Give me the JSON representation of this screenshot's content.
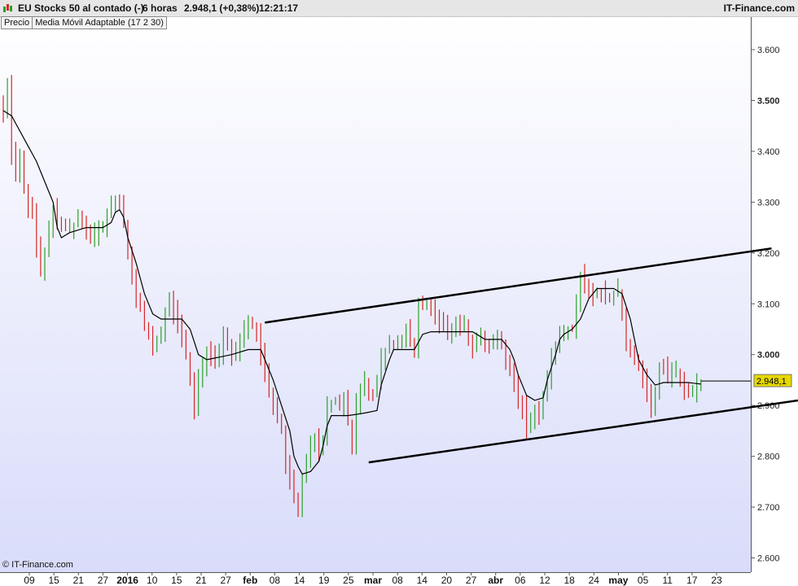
{
  "header": {
    "instrument": "EU Stocks 50 al contado (-)",
    "timeframe": "6 horas",
    "last": "2.948,1 (+0,38%)",
    "time": "12:21:17",
    "brand": "IT-Finance.com"
  },
  "legend": {
    "price": "Precio",
    "indicator": "Media Móvil Adaptable (17 2 30)"
  },
  "copyright": "© IT-Finance.com",
  "colors": {
    "up": "#2ca02c",
    "down": "#d62728",
    "ma": "#000000",
    "trend": "#000000",
    "bg_top": "#ffffff",
    "bg_bottom": "#d9dcfa",
    "price_tag": "#e6d800"
  },
  "chart_data": {
    "type": "line",
    "y_axis": {
      "ticks": [
        3600,
        3500,
        3400,
        3300,
        3200,
        3100,
        3000,
        2900,
        2800,
        2700,
        2600
      ],
      "labels": [
        "3.600",
        "3.500",
        "3.400",
        "3.300",
        "3.200",
        "3.100",
        "3.000",
        "2.900",
        "2.800",
        "2.700",
        "2.600"
      ],
      "bold": [
        3500,
        3000
      ],
      "ylim": [
        2585,
        3670
      ]
    },
    "x_axis": {
      "labels": [
        "09",
        "15",
        "21",
        "27",
        "2016",
        "10",
        "15",
        "21",
        "27",
        "feb",
        "08",
        "14",
        "19",
        "25",
        "mar",
        "08",
        "14",
        "20",
        "27",
        "abr",
        "06",
        "12",
        "18",
        "24",
        "may",
        "05",
        "11",
        "17",
        "23"
      ],
      "bold": [
        "2016",
        "feb",
        "mar",
        "abr",
        "may"
      ]
    },
    "last_price": {
      "value": 2948.1,
      "label": "2.948,1"
    },
    "ma_anchors": [
      [
        0,
        3480
      ],
      [
        2,
        3470
      ],
      [
        4,
        3440
      ],
      [
        6,
        3410
      ],
      [
        8,
        3380
      ],
      [
        10,
        3340
      ],
      [
        12,
        3300
      ],
      [
        13,
        3250
      ],
      [
        14,
        3230
      ],
      [
        16,
        3240
      ],
      [
        20,
        3250
      ],
      [
        24,
        3250
      ],
      [
        26,
        3260
      ],
      [
        27,
        3280
      ],
      [
        28,
        3285
      ],
      [
        29,
        3270
      ],
      [
        30,
        3230
      ],
      [
        32,
        3180
      ],
      [
        34,
        3120
      ],
      [
        36,
        3080
      ],
      [
        38,
        3070
      ],
      [
        43,
        3070
      ],
      [
        45,
        3050
      ],
      [
        47,
        3000
      ],
      [
        49,
        2990
      ],
      [
        55,
        3000
      ],
      [
        59,
        3010
      ],
      [
        62,
        3010
      ],
      [
        63,
        2990
      ],
      [
        65,
        2950
      ],
      [
        67,
        2900
      ],
      [
        69,
        2850
      ],
      [
        70,
        2800
      ],
      [
        71,
        2780
      ],
      [
        72,
        2765
      ],
      [
        74,
        2770
      ],
      [
        76,
        2790
      ],
      [
        77,
        2820
      ],
      [
        78,
        2860
      ],
      [
        79,
        2880
      ],
      [
        83,
        2880
      ],
      [
        87,
        2885
      ],
      [
        90,
        2890
      ],
      [
        91,
        2940
      ],
      [
        93,
        2990
      ],
      [
        94,
        3010
      ],
      [
        99,
        3010
      ],
      [
        101,
        3040
      ],
      [
        103,
        3045
      ],
      [
        113,
        3045
      ],
      [
        116,
        3030
      ],
      [
        120,
        3030
      ],
      [
        122,
        3010
      ],
      [
        123,
        2990
      ],
      [
        124,
        2960
      ],
      [
        126,
        2920
      ],
      [
        128,
        2910
      ],
      [
        130,
        2915
      ],
      [
        131,
        2950
      ],
      [
        133,
        3000
      ],
      [
        134,
        3030
      ],
      [
        135,
        3040
      ],
      [
        137,
        3050
      ],
      [
        139,
        3070
      ],
      [
        141,
        3110
      ],
      [
        143,
        3130
      ],
      [
        147,
        3130
      ],
      [
        149,
        3120
      ],
      [
        151,
        3070
      ],
      [
        152,
        3030
      ],
      [
        153,
        2990
      ],
      [
        155,
        2960
      ],
      [
        157,
        2940
      ],
      [
        159,
        2945
      ],
      [
        161,
        2945
      ],
      [
        165,
        2945
      ],
      [
        168,
        2942
      ]
    ],
    "price_anchors": [
      [
        0,
        3480
      ],
      [
        1,
        3530
      ],
      [
        2,
        3400
      ],
      [
        3,
        3360
      ],
      [
        4,
        3380
      ],
      [
        5,
        3330
      ],
      [
        6,
        3300
      ],
      [
        7,
        3280
      ],
      [
        8,
        3210
      ],
      [
        9,
        3170
      ],
      [
        10,
        3200
      ],
      [
        11,
        3240
      ],
      [
        12,
        3280
      ],
      [
        14,
        3260
      ],
      [
        16,
        3250
      ],
      [
        18,
        3270
      ],
      [
        20,
        3240
      ],
      [
        22,
        3230
      ],
      [
        24,
        3260
      ],
      [
        26,
        3290
      ],
      [
        27,
        3310
      ],
      [
        28,
        3300
      ],
      [
        29,
        3260
      ],
      [
        30,
        3190
      ],
      [
        32,
        3120
      ],
      [
        34,
        3060
      ],
      [
        36,
        3020
      ],
      [
        38,
        3050
      ],
      [
        40,
        3110
      ],
      [
        42,
        3060
      ],
      [
        44,
        3000
      ],
      [
        45,
        2940
      ],
      [
        46,
        2890
      ],
      [
        47,
        2950
      ],
      [
        49,
        3010
      ],
      [
        51,
        2980
      ],
      [
        53,
        3040
      ],
      [
        55,
        3000
      ],
      [
        57,
        3030
      ],
      [
        59,
        3060
      ],
      [
        61,
        3040
      ],
      [
        62,
        3000
      ],
      [
        63,
        2960
      ],
      [
        65,
        2900
      ],
      [
        67,
        2850
      ],
      [
        68,
        2780
      ],
      [
        69,
        2760
      ],
      [
        70,
        2720
      ],
      [
        71,
        2700
      ],
      [
        72,
        2760
      ],
      [
        74,
        2820
      ],
      [
        75,
        2830
      ],
      [
        76,
        2800
      ],
      [
        77,
        2830
      ],
      [
        78,
        2900
      ],
      [
        80,
        2910
      ],
      [
        82,
        2910
      ],
      [
        83,
        2870
      ],
      [
        84,
        2830
      ],
      [
        85,
        2900
      ],
      [
        87,
        2940
      ],
      [
        89,
        2920
      ],
      [
        91,
        2990
      ],
      [
        93,
        3020
      ],
      [
        95,
        3020
      ],
      [
        97,
        3040
      ],
      [
        99,
        3000
      ],
      [
        100,
        3110
      ],
      [
        101,
        3090
      ],
      [
        103,
        3090
      ],
      [
        105,
        3070
      ],
      [
        107,
        3040
      ],
      [
        109,
        3060
      ],
      [
        111,
        3050
      ],
      [
        113,
        3020
      ],
      [
        115,
        3040
      ],
      [
        117,
        3010
      ],
      [
        119,
        3040
      ],
      [
        121,
        2990
      ],
      [
        123,
        2940
      ],
      [
        125,
        2900
      ],
      [
        126,
        2860
      ],
      [
        127,
        2880
      ],
      [
        129,
        2890
      ],
      [
        130,
        2920
      ],
      [
        132,
        2990
      ],
      [
        134,
        3040
      ],
      [
        135,
        3050
      ],
      [
        137,
        3050
      ],
      [
        138,
        3100
      ],
      [
        139,
        3150
      ],
      [
        140,
        3130
      ],
      [
        142,
        3120
      ],
      [
        144,
        3120
      ],
      [
        146,
        3110
      ],
      [
        148,
        3130
      ],
      [
        149,
        3070
      ],
      [
        150,
        3030
      ],
      [
        152,
        2990
      ],
      [
        154,
        2960
      ],
      [
        156,
        2900
      ],
      [
        157,
        2920
      ],
      [
        158,
        2980
      ],
      [
        160,
        2960
      ],
      [
        162,
        2970
      ],
      [
        164,
        2930
      ],
      [
        166,
        2925
      ],
      [
        168,
        2948
      ]
    ],
    "trendlines": [
      {
        "from": [
          63,
          3063
        ],
        "to": [
          185,
          3209
        ]
      },
      {
        "from": [
          88,
          2788
        ],
        "to": [
          200,
          2920
        ]
      }
    ]
  }
}
